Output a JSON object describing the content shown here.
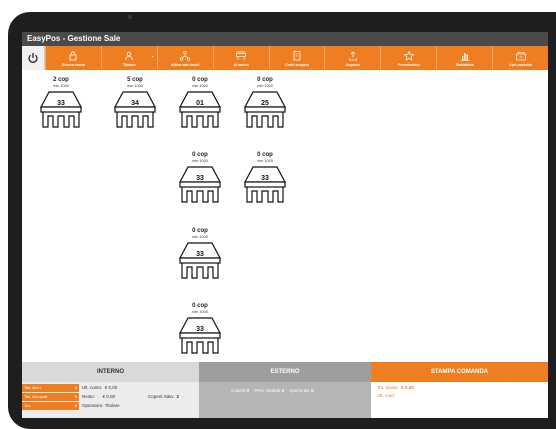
{
  "app_title": "EasyPos - Gestione Sale",
  "toolbar": [
    {
      "label": "Blocca cassa",
      "icon": "lock-icon"
    },
    {
      "label": "Titolare",
      "icon": "user-icon",
      "caret": "⌄"
    },
    {
      "label": "Attiva sale tavoli",
      "icon": "network-icon"
    },
    {
      "label": "Al banco",
      "icon": "counter-icon"
    },
    {
      "label": "Conti sospesi",
      "icon": "receipt-icon"
    },
    {
      "label": "Asporto",
      "icon": "upload-icon"
    },
    {
      "label": "Prenotazioni",
      "icon": "star-icon"
    },
    {
      "label": "Statistiche",
      "icon": "chart-icon"
    },
    {
      "label": "Apri cassetto",
      "icon": "drawer-icon"
    }
  ],
  "tables": [
    {
      "coperti": "2 cop",
      "min": "min 1000",
      "number": "33"
    },
    {
      "coperti": "5 cop",
      "min": "min 1000",
      "number": "34"
    },
    {
      "coperti": "0 cop",
      "min": "min 1000",
      "number": "01"
    },
    {
      "coperti": "0 cop",
      "min": "min 1000",
      "number": "25"
    },
    {
      "coperti": "0 cop",
      "min": "min 1000",
      "number": "33"
    },
    {
      "coperti": "0 cop",
      "min": "min 1000",
      "number": "33"
    },
    {
      "coperti": "0 cop",
      "min": "min 1000",
      "number": "33"
    },
    {
      "coperti": "0 cop",
      "min": "min 1000",
      "number": "33"
    }
  ],
  "footer": {
    "interno": {
      "title": "INTERNO",
      "stats": [
        {
          "label": "Tav. liberi",
          "value": "8"
        },
        {
          "label": "Tav. occupati",
          "value": "5"
        },
        {
          "label": "Tav.",
          "value": "8"
        }
      ],
      "ult_conto_label": "Ult. conto:",
      "ult_conto_value": "€ 0,00",
      "resto_label": "Resto:",
      "resto_value": "€ 0,00",
      "operatore_label": "Operatore:",
      "operatore_value": "Titolare",
      "coperti_sala_label": "Coperti Sala:",
      "coperti_sala_value": "2"
    },
    "esterno": {
      "title": "ESTERNO",
      "coperti_label": "Coperti",
      "coperti_value": "0",
      "pers_seduta_label": "Pers. Seduta",
      "pers_seduta_value": "0",
      "aperto_da_label": "Aperto da:",
      "aperto_da_value": "0"
    },
    "stampa": {
      "title": "STAMPA COMANDA",
      "tot_tavolo_label": "Tot. tavolo:",
      "tot_tavolo_value": "€ 0,00",
      "ult_mod_label": "Ult. mod."
    }
  }
}
